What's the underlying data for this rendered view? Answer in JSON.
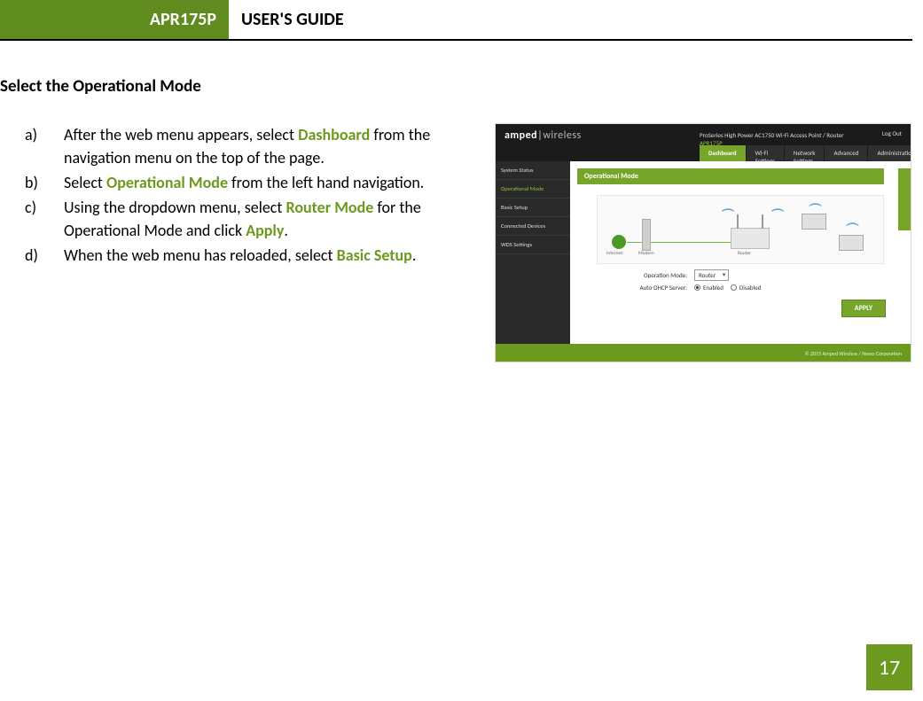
{
  "header": {
    "model": "APR175P",
    "title": "USER'S GUIDE"
  },
  "section_title": "Select the Operational Mode",
  "steps": [
    {
      "marker": "a)",
      "parts": [
        {
          "t": "After the web menu appears, select "
        },
        {
          "t": "Dashboard",
          "cls": "kw"
        },
        {
          "t": " from the navigation menu on the top of the page."
        }
      ]
    },
    {
      "marker": "b)",
      "parts": [
        {
          "t": "Select "
        },
        {
          "t": "Operational Mode",
          "cls": "kw"
        },
        {
          "t": " from the left hand navigation."
        }
      ]
    },
    {
      "marker": "c)",
      "parts": [
        {
          "t": "Using the dropdown menu, select "
        },
        {
          "t": "Router Mode",
          "cls": "kw"
        },
        {
          "t": " for the Operational Mode and click "
        },
        {
          "t": "Apply",
          "cls": "kw"
        },
        {
          "t": "."
        }
      ]
    },
    {
      "marker": "d)",
      "parts": [
        {
          "t": "When the web menu has reloaded, select "
        },
        {
          "t": "Basic Setup",
          "cls": "kw"
        },
        {
          "t": "."
        }
      ]
    }
  ],
  "shot": {
    "brand_a": "amped",
    "brand_bar": "|",
    "brand_b": "wireless",
    "subtitle_line": "ProSeries High Power AC1750 Wi-Fi Access Point / Router",
    "subtitle_model": "APR175P",
    "logout": "Log Out",
    "topnav": [
      "Dashboard",
      "Wi-Fi Settings",
      "Network Settings",
      "Advanced",
      "Administration"
    ],
    "topnav_active": 0,
    "sidenav": [
      "System Status",
      "Operational Mode",
      "Basic Setup",
      "Connected Devices",
      "WDS Settings"
    ],
    "sidenav_active": 1,
    "panel_title": "Operational Mode",
    "diagram_labels": {
      "internet": "Internet",
      "modem": "Modem",
      "router": "Router"
    },
    "form": {
      "op_label": "Operation Mode:",
      "op_value": "Router",
      "dhcp_label": "Auto-DHCP Server:",
      "opt_enabled": "Enabled",
      "opt_disabled": "Disabled"
    },
    "apply": "APPLY",
    "footer": "© 2015 Amped Wireless / Newo Corporation"
  },
  "page_number": "17"
}
